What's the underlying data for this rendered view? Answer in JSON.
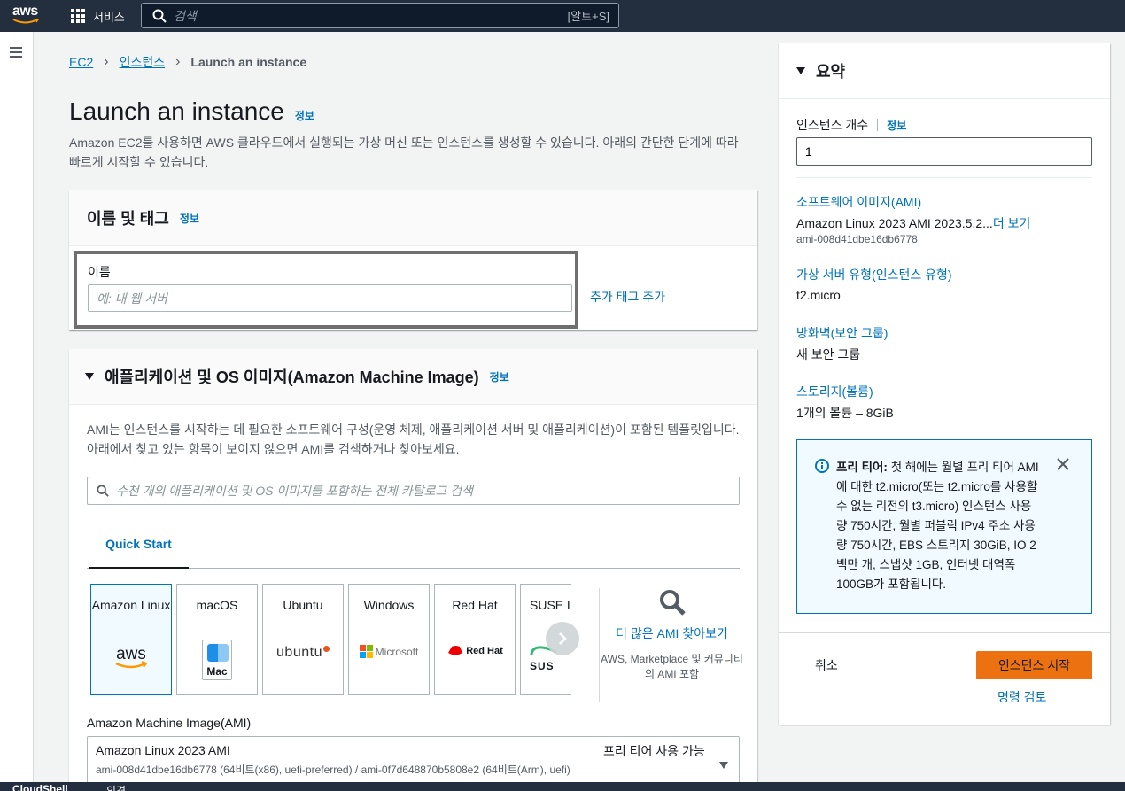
{
  "topbar": {
    "logo_text": "aws",
    "services_label": "서비스",
    "search_placeholder": "검색",
    "search_shortcut": "[알트+S]"
  },
  "breadcrumb": {
    "items": [
      "EC2",
      "인스턴스"
    ],
    "current": "Launch an instance"
  },
  "page": {
    "title": "Launch an instance",
    "info": "정보",
    "description": "Amazon EC2를 사용하면 AWS 클라우드에서 실행되는 가상 머신 또는 인스턴스를 생성할 수 있습니다. 아래의 간단한 단계에 따라 빠르게 시작할 수 있습니다."
  },
  "name_section": {
    "title": "이름 및 태그",
    "info": "정보",
    "name_label": "이름",
    "name_placeholder": "예: 내 웹 서버",
    "add_tags": "추가 태그 추가"
  },
  "ami_section": {
    "title": "애플리케이션 및 OS 이미지(Amazon Machine Image)",
    "info": "정보",
    "description": "AMI는 인스턴스를 시작하는 데 필요한 소프트웨어 구성(운영 체제, 애플리케이션 서버 및 애플리케이션)이 포함된 템플릿입니다. 아래에서 찾고 있는 항목이 보이지 않으면 AMI를 검색하거나 찾아보세요.",
    "search_placeholder": "수천 개의 애플리케이션 및 OS 이미지를 포함하는 전체 카탈로그 검색",
    "tab_quick_start": "Quick Start",
    "os_cards": [
      {
        "name": "Amazon Linux",
        "logo": "aws",
        "selected": true
      },
      {
        "name": "macOS",
        "logo": "Mac",
        "selected": false
      },
      {
        "name": "Ubuntu",
        "logo": "ubuntu",
        "selected": false
      },
      {
        "name": "Windows",
        "logo": "Microsoft",
        "selected": false
      },
      {
        "name": "Red Hat",
        "logo": "Red Hat",
        "selected": false
      },
      {
        "name": "SUSE Li",
        "logo": "SUS",
        "selected": false
      }
    ],
    "browse_more": "더 많은 AMI 찾아보기",
    "browse_more_sub": "AWS, Marketplace 및 커뮤니티의 AMI 포함",
    "ami_label": "Amazon Machine Image(AMI)",
    "ami_selected_name": "Amazon Linux 2023 AMI",
    "ami_selected_ids": "ami-008d41dbe16db6778 (64비트(x86), uefi-preferred) / ami-0f7d648870b5808e2 (64비트(Arm), uefi)",
    "ami_free_tier": "프리 티어 사용 가능"
  },
  "summary": {
    "title": "요약",
    "count_label": "인스턴스 개수",
    "count_info": "정보",
    "count_value": "1",
    "software_image_label": "소프트웨어 이미지(AMI)",
    "software_image_value": "Amazon Linux 2023 AMI 2023.5.2...",
    "software_image_more": "더 보기",
    "software_image_id": "ami-008d41dbe16db6778",
    "instance_type_label": "가상 서버 유형(인스턴스 유형)",
    "instance_type_value": "t2.micro",
    "firewall_label": "방화벽(보안 그룹)",
    "firewall_value": "새 보안 그룹",
    "storage_label": "스토리지(볼륨)",
    "storage_value": "1개의 볼륨 – 8GiB",
    "free_tier_bold": "프리 티어:",
    "free_tier_text": "첫 해에는 월별 프리 티어 AMI에 대한 t2.micro(또는 t2.micro를 사용할 수 없는 리전의 t3.micro) 인스턴스 사용량 750시간, 월별 퍼블릭 IPv4 주소 사용량 750시간, EBS 스토리지 30GiB, IO 2백만 개, 스냅샷 1GB, 인터넷 대역폭 100GB가 포함됩니다.",
    "cancel": "취소",
    "launch": "인스턴스 시작",
    "review_commands": "명령 검토"
  },
  "bottombar": {
    "cloudshell": "CloudShell",
    "feedback": "의견"
  },
  "colors": {
    "nav_bg": "#232f3e",
    "link": "#0073bb",
    "primary_button": "#ec7211",
    "info_box_bg": "#f1faff"
  }
}
